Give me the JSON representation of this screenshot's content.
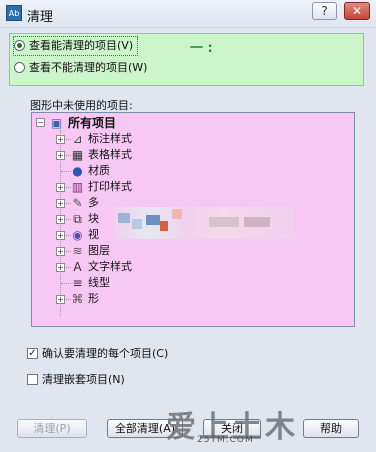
{
  "window": {
    "icon_text": "Ab",
    "title": "清理",
    "help_glyph": "?",
    "close_glyph": "✕"
  },
  "view_options": {
    "selected_label": "查看能清理的项目(V)",
    "unselected_label": "查看不能清理的项目(W)",
    "annotation": "一 :"
  },
  "tree": {
    "section_label": "图形中未使用的项目:",
    "root": "所有项目",
    "items": [
      {
        "label": "标注样式",
        "icon": "dimension-style-icon",
        "glyph": "⊿",
        "expandable": true
      },
      {
        "label": "表格样式",
        "icon": "table-style-icon",
        "glyph": "▦",
        "expandable": true
      },
      {
        "label": "材质",
        "icon": "material-icon",
        "glyph": "●",
        "expandable": false
      },
      {
        "label": "打印样式",
        "icon": "plot-style-icon",
        "glyph": "▥",
        "expandable": true
      },
      {
        "label": "多线样式",
        "icon": "multiline-style-icon",
        "glyph": "✎",
        "expandable": true
      },
      {
        "label": "块",
        "icon": "block-icon",
        "glyph": "⧉",
        "expandable": true
      },
      {
        "label": "视觉样式",
        "icon": "visual-style-icon",
        "glyph": "◉",
        "expandable": true
      },
      {
        "label": "图层",
        "icon": "layer-icon",
        "glyph": "≋",
        "expandable": true
      },
      {
        "label": "文字样式",
        "icon": "text-style-icon",
        "glyph": "A",
        "expandable": true
      },
      {
        "label": "线型",
        "icon": "linetype-icon",
        "glyph": "≡",
        "expandable": false
      },
      {
        "label": "形",
        "icon": "shape-icon",
        "glyph": "⌘",
        "expandable": true
      }
    ],
    "visible_labels": [
      "标注样式",
      "表格样式",
      "材质",
      "打印样式",
      "多",
      "块",
      "视",
      "图层",
      "文字样式",
      "线型",
      "形"
    ]
  },
  "checks": {
    "confirm_label": "确认要清理的每个项目(C)",
    "confirm_checked": true,
    "nested_label": "清理嵌套项目(N)",
    "nested_checked": false
  },
  "buttons": {
    "purge": "清理(P)",
    "purge_all": "全部清理(A)",
    "close": "关闭",
    "help": "帮助"
  },
  "watermark": {
    "main": "爱上土木",
    "sub": "25TM.COM"
  },
  "colors": {
    "option_panel_bg": "#ccf5cc",
    "tree_bg": "#f8c8f4",
    "window_bg": "#dfe6f0"
  }
}
